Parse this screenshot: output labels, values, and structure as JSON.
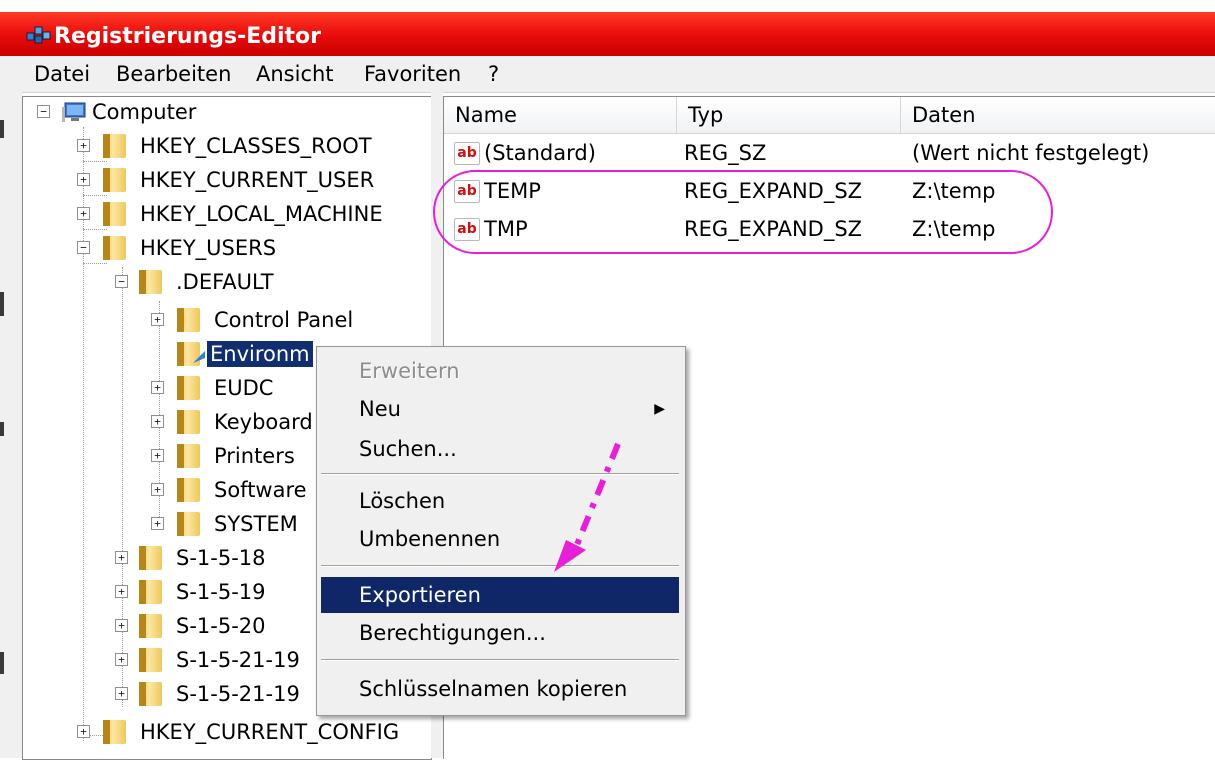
{
  "window": {
    "title": "Registrierungs-Editor"
  },
  "menubar": [
    "Datei",
    "Bearbeiten",
    "Ansicht",
    "Favoriten",
    "?"
  ],
  "tree": {
    "root": "Computer",
    "hives": [
      "HKEY_CLASSES_ROOT",
      "HKEY_CURRENT_USER",
      "HKEY_LOCAL_MACHINE",
      "HKEY_USERS"
    ],
    "users": {
      "default": ".DEFAULT",
      "default_children": [
        "Control Panel",
        "Environm",
        "EUDC",
        "Keyboard",
        "Printers",
        "Software",
        "SYSTEM"
      ],
      "sids": [
        "S-1-5-18",
        "S-1-5-19",
        "S-1-5-20",
        "S-1-5-21-19",
        "S-1-5-21-19"
      ]
    },
    "current_config": "HKEY_CURRENT_CONFIG"
  },
  "list": {
    "columns": [
      "Name",
      "Typ",
      "Daten"
    ],
    "rows": [
      {
        "icon": "ab",
        "name": "(Standard)",
        "type": "REG_SZ",
        "data": "(Wert nicht festgelegt)"
      },
      {
        "icon": "ab",
        "name": "TEMP",
        "type": "REG_EXPAND_SZ",
        "data": "Z:\\temp"
      },
      {
        "icon": "ab",
        "name": "TMP",
        "type": "REG_EXPAND_SZ",
        "data": "Z:\\temp"
      }
    ]
  },
  "context_menu": {
    "items": [
      "Erweitern",
      "Neu",
      "Suchen...",
      "Löschen",
      "Umbenennen",
      "Exportieren",
      "Berechtigungen...",
      "Schlüsselnamen kopieren"
    ],
    "submenu_arrow": "▶"
  },
  "colors": {
    "title_bar": "#e80a0a",
    "selection": "#112e6f",
    "annotation": "#e81fd9"
  }
}
